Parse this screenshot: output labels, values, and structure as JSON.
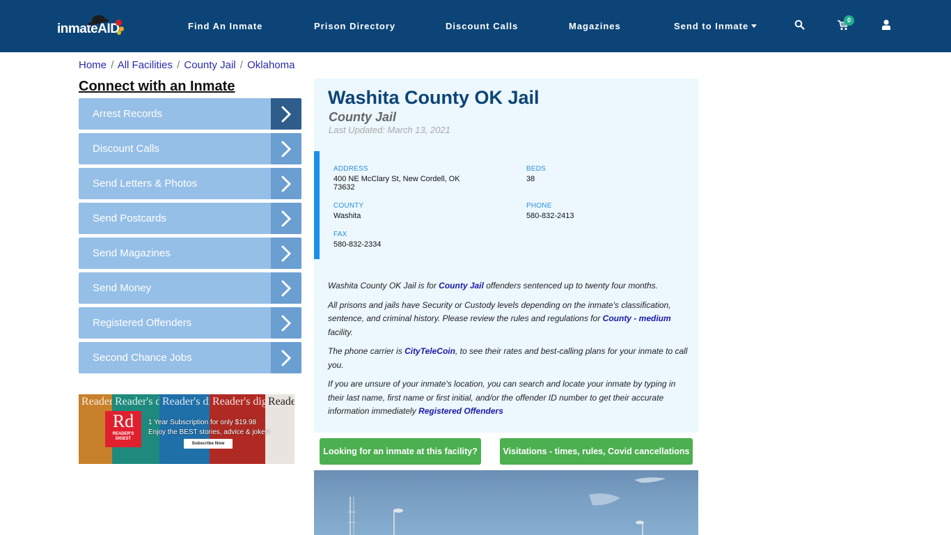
{
  "navbar": {
    "logo_text": "inmateAID",
    "items": [
      {
        "label": "Find An Inmate"
      },
      {
        "label": "Prison Directory"
      },
      {
        "label": "Discount Calls"
      },
      {
        "label": "Magazines"
      },
      {
        "label": "Send to Inmate",
        "has_dropdown": true
      }
    ],
    "icons": {
      "search": "search-icon",
      "cart": "cart-icon",
      "user": "user-icon"
    },
    "cart_count": "0",
    "brand_color": "#0c4477",
    "badge_color": "#1fae8e"
  },
  "breadcrumb": [
    {
      "label": "Home"
    },
    {
      "label": "All Facilities"
    },
    {
      "label": "County Jail"
    },
    {
      "label": "Oklahoma"
    }
  ],
  "breadcrumb_separator": "/",
  "sidebar": {
    "title": "Connect with an Inmate",
    "items": [
      {
        "label": "Arrest Records",
        "active": true
      },
      {
        "label": "Discount Calls"
      },
      {
        "label": "Send Letters & Photos"
      },
      {
        "label": "Send Postcards"
      },
      {
        "label": "Send Magazines"
      },
      {
        "label": "Send Money"
      },
      {
        "label": "Registered Offenders"
      },
      {
        "label": "Second Chance Jobs"
      }
    ]
  },
  "ad": {
    "masthead": "Reader's digest",
    "logo": "Rd",
    "logo_sub": "READER'S DIGEST",
    "line1": "1 Year Subscription for only $19.98",
    "line2": "Enjoy the BEST stories, advice & jokes!",
    "button": "Subscribe Now"
  },
  "facility": {
    "name": "Washita County OK Jail",
    "type": "County Jail",
    "last_updated": "Last Updated: March 13, 2021",
    "info": {
      "address_label": "ADDRESS",
      "address": "400 NE McClary St, New Cordell, OK 73632",
      "beds_label": "BEDS",
      "beds": "38",
      "county_label": "COUNTY",
      "county": "Washita",
      "phone_label": "PHONE",
      "phone": "580-832-2413",
      "fax_label": "FAX",
      "fax": "580-832-2334"
    },
    "description": {
      "p1_pre": "Washita County OK Jail is for ",
      "p1_link": "County Jail",
      "p1_post": " offenders sentenced up to twenty four months.",
      "p2_pre": "All prisons and jails have Security or Custody levels depending on the inmate's classification, sentence, and criminal history. Please review the rules and regulations for ",
      "p2_link": "County - medium",
      "p2_post": " facility.",
      "p3_pre": "The phone carrier is ",
      "p3_link": "CityTeleCoin",
      "p3_post": ", to see their rates and best-calling plans for your inmate to call you.",
      "p4_pre": "If you are unsure of your inmate's location, you can search and locate your inmate by typing in their last name, first name or first initial, and/or the offender ID number to get their accurate information immediately ",
      "p4_link": "Registered Offenders"
    }
  },
  "buttons": {
    "find_inmate": "Looking for an inmate at this facility?",
    "visitations": "Visitations - times, rules, Covid cancellations",
    "color": "#4caf50"
  }
}
